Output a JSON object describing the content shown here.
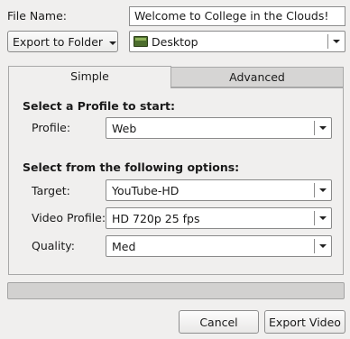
{
  "file": {
    "label": "File Name:",
    "value": "Welcome to College in the Clouds!"
  },
  "export_target": {
    "selected": "Export to Folder"
  },
  "folder": {
    "selected": "Desktop",
    "icon": "folder-icon"
  },
  "tabs": [
    {
      "label": "Simple",
      "active": true
    },
    {
      "label": "Advanced",
      "active": false
    }
  ],
  "profile_section": {
    "heading": "Select a Profile to start:",
    "profile": {
      "label": "Profile:",
      "selected": "Web"
    }
  },
  "options_section": {
    "heading": "Select from the following options:",
    "target": {
      "label": "Target:",
      "selected": "YouTube-HD"
    },
    "video_profile": {
      "label": "Video Profile:",
      "selected": "HD 720p 25 fps"
    },
    "quality": {
      "label": "Quality:",
      "selected": "Med"
    }
  },
  "progress": {
    "fraction": 0
  },
  "buttons": {
    "cancel": "Cancel",
    "export": "Export Video"
  }
}
